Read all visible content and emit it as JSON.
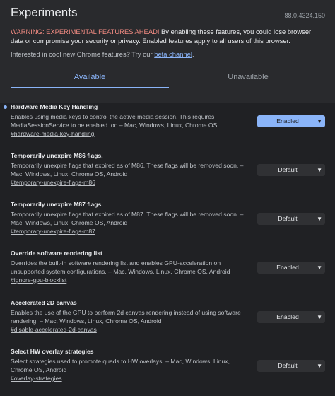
{
  "header": {
    "title": "Experiments",
    "version": "88.0.4324.150",
    "warning_strong": "WARNING: EXPERIMENTAL FEATURES AHEAD!",
    "warning_rest": " By enabling these features, you could lose browser data or compromise your security or privacy. Enabled features apply to all users of this browser.",
    "interest_text": "Interested in cool new Chrome features? Try our ",
    "interest_link": "beta channel",
    "interest_end": "."
  },
  "tabs": {
    "available": "Available",
    "unavailable": "Unavailable"
  },
  "experiments": [
    {
      "name": "Hardware Media Key Handling",
      "description": "Enables using media keys to control the active media session. This requires MediaSessionService to be enabled too – Mac, Windows, Linux, Chrome OS",
      "link": "#hardware-media-key-handling",
      "value": "Enabled"
    },
    {
      "name": "Temporarily unexpire M86 flags.",
      "description": "Temporarily unexpire flags that expired as of M86. These flags will be removed soon. – Mac, Windows, Linux, Chrome OS, Android",
      "link": "#temporary-unexpire-flags-m86",
      "value": "Default"
    },
    {
      "name": "Temporarily unexpire M87 flags.",
      "description": "Temporarily unexpire flags that expired as of M87. These flags will be removed soon. – Mac, Windows, Linux, Chrome OS, Android",
      "link": "#temporary-unexpire-flags-m87",
      "value": "Default"
    },
    {
      "name": "Override software rendering list",
      "description": "Overrides the built-in software rendering list and enables GPU-acceleration on unsupported system configurations. – Mac, Windows, Linux, Chrome OS, Android",
      "link": "#ignore-gpu-blocklist",
      "value": "Enabled"
    },
    {
      "name": "Accelerated 2D canvas",
      "description": "Enables the use of the GPU to perform 2d canvas rendering instead of using software rendering. – Mac, Windows, Linux, Chrome OS, Android",
      "link": "#disable-accelerated-2d-canvas",
      "value": "Enabled"
    },
    {
      "name": "Select HW overlay strategies",
      "description": "Select strategies used to promote quads to HW overlays. – Mac, Windows, Linux, Chrome OS, Android",
      "link": "#overlay-strategies",
      "value": "Default"
    }
  ]
}
